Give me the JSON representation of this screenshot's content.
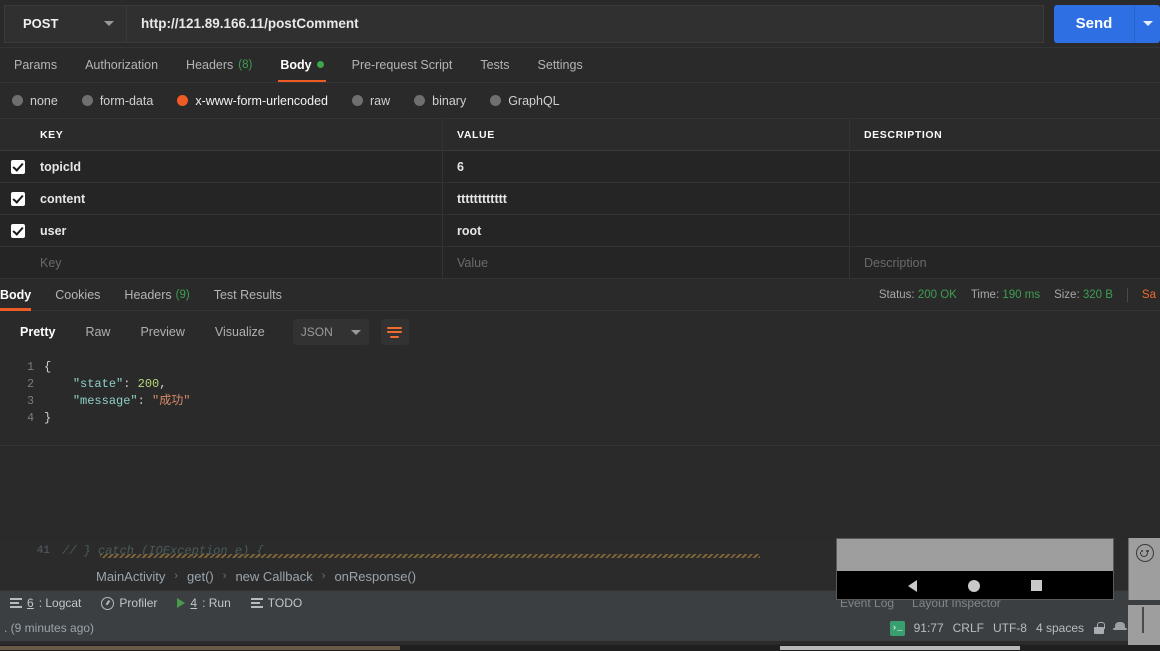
{
  "request": {
    "method": "POST",
    "url": "http://121.89.166.11/postComment",
    "send_label": "Send",
    "tabs": [
      {
        "label": "Params",
        "count": "",
        "dot": false,
        "active": false
      },
      {
        "label": "Authorization",
        "count": "",
        "dot": false,
        "active": false
      },
      {
        "label": "Headers",
        "count": "(8)",
        "dot": false,
        "active": false
      },
      {
        "label": "Body",
        "count": "",
        "dot": true,
        "active": true
      },
      {
        "label": "Pre-request Script",
        "count": "",
        "dot": false,
        "active": false
      },
      {
        "label": "Tests",
        "count": "",
        "dot": false,
        "active": false
      },
      {
        "label": "Settings",
        "count": "",
        "dot": false,
        "active": false
      }
    ],
    "body_types": [
      {
        "label": "none",
        "selected": false
      },
      {
        "label": "form-data",
        "selected": false
      },
      {
        "label": "x-www-form-urlencoded",
        "selected": true
      },
      {
        "label": "raw",
        "selected": false
      },
      {
        "label": "binary",
        "selected": false
      },
      {
        "label": "GraphQL",
        "selected": false
      }
    ],
    "table": {
      "headers": {
        "key": "KEY",
        "value": "VALUE",
        "description": "DESCRIPTION"
      },
      "rows": [
        {
          "checked": true,
          "key": "topicId",
          "value": "6",
          "description": ""
        },
        {
          "checked": true,
          "key": "content",
          "value": "tttttttttttt",
          "description": ""
        },
        {
          "checked": true,
          "key": "user",
          "value": "root",
          "description": ""
        }
      ],
      "placeholder_row": {
        "key": "Key",
        "value": "Value",
        "description": "Description"
      }
    }
  },
  "response": {
    "tabs": [
      {
        "label": "Body",
        "count": "",
        "active": true
      },
      {
        "label": "Cookies",
        "count": "",
        "active": false
      },
      {
        "label": "Headers",
        "count": "(9)",
        "active": false
      },
      {
        "label": "Test Results",
        "count": "",
        "active": false
      }
    ],
    "meta": {
      "status_label": "Status:",
      "status_value": "200 OK",
      "time_label": "Time:",
      "time_value": "190 ms",
      "size_label": "Size:",
      "size_value": "320 B",
      "save_label": "Sa"
    },
    "view_modes": [
      {
        "label": "Pretty",
        "active": true
      },
      {
        "label": "Raw",
        "active": false
      },
      {
        "label": "Preview",
        "active": false
      },
      {
        "label": "Visualize",
        "active": false
      }
    ],
    "format": "JSON",
    "body_lines": [
      "1",
      "2",
      "3",
      "4"
    ],
    "body_json": {
      "open_brace": "{",
      "key_state": "\"state\"",
      "val_state": "200",
      "key_message": "\"message\"",
      "val_message": "\"成功\"",
      "close_brace": "}",
      "colon": ": ",
      "comma": ","
    }
  },
  "studio": {
    "code_line_number": "41",
    "code_text": "//            } catch (IOException e) {",
    "breadcrumb": [
      "MainActivity",
      "get()",
      "new Callback",
      "onResponse()"
    ],
    "breadcrumb_sep": "›",
    "tool_windows": [
      {
        "num": "6",
        "label": ": Logcat",
        "icon": "bars-icon"
      },
      {
        "num": "",
        "label": "Profiler",
        "icon": "profiler-icon"
      },
      {
        "num": "4",
        "label": ": Run",
        "icon": "play-icon"
      },
      {
        "num": "",
        "label": "TODO",
        "icon": "list-icon"
      }
    ],
    "hidden_tool_windows": [
      "Event Log",
      "Layout Inspector"
    ],
    "status_left": ". (9 minutes ago)",
    "status_right": {
      "badge": "›_",
      "caret_pos": "91:77",
      "line_sep": "CRLF",
      "encoding": "UTF-8",
      "indent": "4 spaces"
    }
  },
  "emulator": {
    "nav_back": "back-icon",
    "nav_home": "home-icon",
    "nav_recent": "recents-icon",
    "side_icon": "smiley-icon"
  },
  "colors": {
    "accent_orange": "#ef5b25",
    "send_blue": "#2f6fe4",
    "status_green": "#3f9e52",
    "bg_dark": "#2a2a2a"
  }
}
